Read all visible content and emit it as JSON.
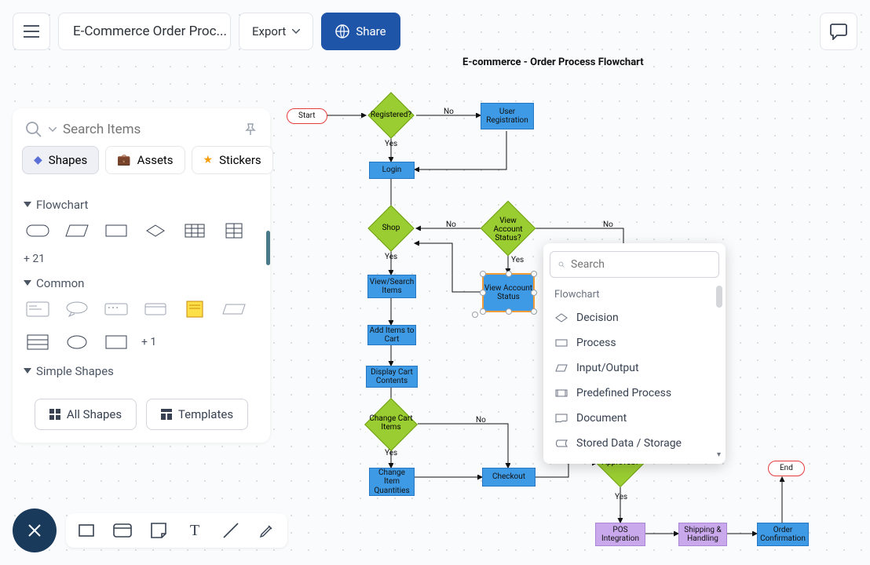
{
  "header": {
    "title": "E-Commerce Order Proc...",
    "export_label": "Export",
    "share_label": "Share"
  },
  "sidebar": {
    "search_placeholder": "Search Items",
    "tabs": [
      {
        "label": "Shapes",
        "active": true
      },
      {
        "label": "Assets",
        "active": false
      },
      {
        "label": "Stickers",
        "active": false
      }
    ],
    "categories": {
      "flowchart": {
        "title": "Flowchart",
        "more": "+ 21"
      },
      "common": {
        "title": "Common",
        "more": "+ 1"
      },
      "simple": {
        "title": "Simple Shapes"
      }
    },
    "actions": {
      "all_shapes": "All Shapes",
      "templates": "Templates"
    }
  },
  "canvas": {
    "title": "E-commerce - Order Process Flowchart",
    "nodes": {
      "start": "Start",
      "end": "End",
      "registered": "Registered?",
      "user_reg": "User Registration",
      "login": "Login",
      "shop": "Shop",
      "view_acct_q": "View Account Status?",
      "view_acct": "View Account Status",
      "view_search": "View/Search Items",
      "add_items": "Add Items to Cart",
      "display_cart": "Display Cart Contents",
      "change_cart": "Change Cart Items",
      "change_qty": "Change Item Quantities",
      "checkout": "Checkout",
      "approved": "Approved?",
      "pos": "POS Integration",
      "shipping": "Shipping & Handling",
      "order_conf": "Order Confirmation"
    },
    "labels": {
      "yes": "Yes",
      "no": "No"
    }
  },
  "context_popup": {
    "search_placeholder": "Search",
    "heading": "Flowchart",
    "items": [
      "Decision",
      "Process",
      "Input/Output",
      "Predefined Process",
      "Document",
      "Stored Data / Storage"
    ]
  }
}
